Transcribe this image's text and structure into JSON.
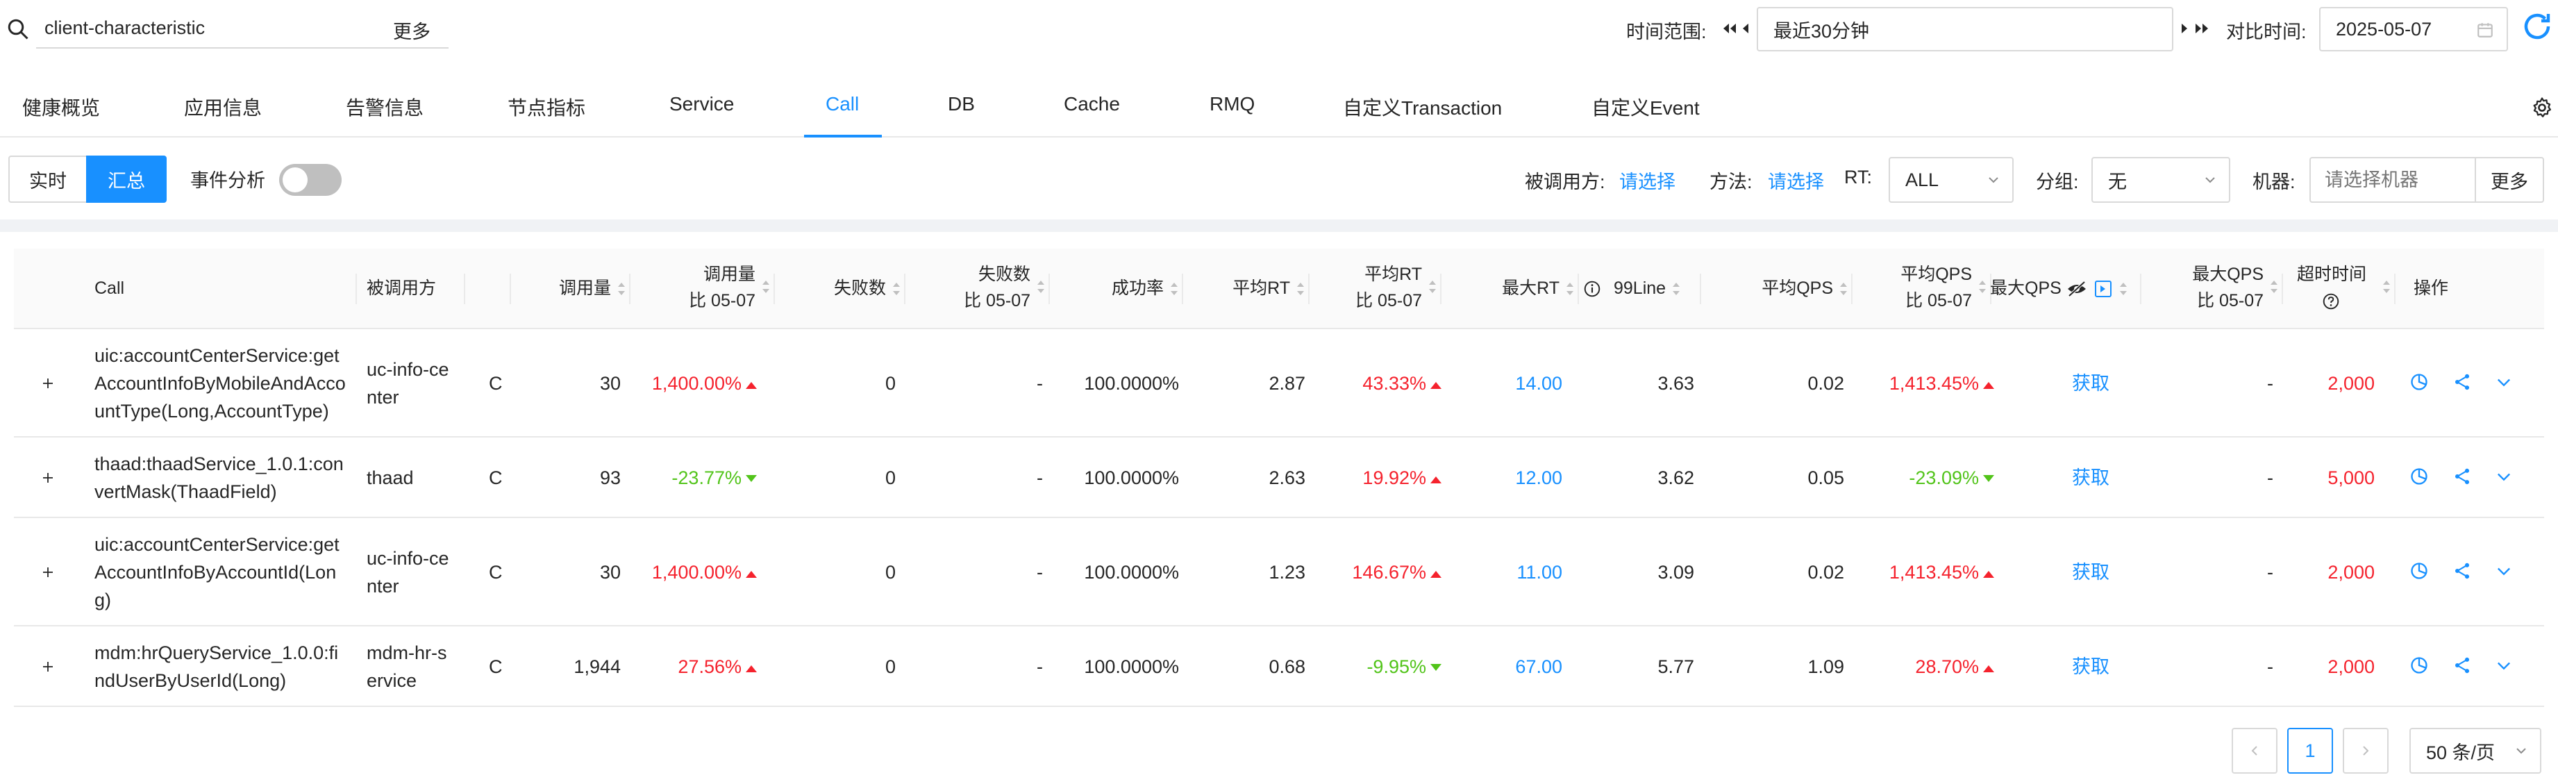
{
  "search": {
    "value": "client-characteristic",
    "more": "更多"
  },
  "time": {
    "label": "时间范围:",
    "range": "最近30分钟",
    "compare_label": "对比时间:",
    "compare_date": "2025-05-07"
  },
  "tabs": [
    "健康概览",
    "应用信息",
    "告警信息",
    "节点指标",
    "Service",
    "Call",
    "DB",
    "Cache",
    "RMQ",
    "自定义Transaction",
    "自定义Event"
  ],
  "active_tab": "Call",
  "mode": {
    "realtime": "实时",
    "summary": "汇总",
    "event_analysis": "事件分析",
    "event_analysis_on": false
  },
  "filters": {
    "callee_label": "被调用方:",
    "callee_value": "请选择",
    "method_label": "方法:",
    "method_value": "请选择",
    "rt_label": "RT:",
    "rt_value": "ALL",
    "group_label": "分组:",
    "group_value": "无",
    "machine_label": "机器:",
    "machine_placeholder": "请选择机器",
    "machine_more": "更多"
  },
  "columns": {
    "call": "Call",
    "callee": "被调用方",
    "calls": "调用量",
    "calls_cmp_1": "调用量",
    "calls_cmp_2": "比 05-07",
    "fails": "失败数",
    "fails_cmp_1": "失败数",
    "fails_cmp_2": "比 05-07",
    "success": "成功率",
    "avg_rt": "平均RT",
    "avg_rt_cmp_1": "平均RT",
    "avg_rt_cmp_2": "比 05-07",
    "max_rt": "最大RT",
    "line99": "99Line",
    "avg_qps": "平均QPS",
    "avg_qps_cmp_1": "平均QPS",
    "avg_qps_cmp_2": "比 05-07",
    "max_qps": "最大QPS",
    "max_qps_cmp_1": "最大QPS",
    "max_qps_cmp_2": "比 05-07",
    "timeout": "超时时间",
    "ops": "操作"
  },
  "rows": [
    {
      "call_lines": [
        "uic:accountCenterService:get",
        "AccountInfoByMobileAndAcco",
        "untType(Long,AccountType)"
      ],
      "callee_lines": [
        "uc-info-ce",
        "nter"
      ],
      "type": "C",
      "calls": "30",
      "calls_cmp": "1,400.00%",
      "calls_cmp_dir": "up",
      "fails": "0",
      "fails_cmp": "-",
      "success": "100.0000%",
      "avg_rt": "2.87",
      "avg_rt_cmp": "43.33%",
      "avg_rt_cmp_dir": "up",
      "max_rt": "14.00",
      "line99": "3.63",
      "avg_qps": "0.02",
      "avg_qps_cmp": "1,413.45%",
      "avg_qps_cmp_dir": "up",
      "max_qps": "获取",
      "max_qps_cmp": "-",
      "timeout": "2,000"
    },
    {
      "call_lines": [
        "thaad:thaadService_1.0.1:con",
        "vertMask(ThaadField)"
      ],
      "callee_lines": [
        "thaad"
      ],
      "type": "C",
      "calls": "93",
      "calls_cmp": "-23.77%",
      "calls_cmp_dir": "down",
      "fails": "0",
      "fails_cmp": "-",
      "success": "100.0000%",
      "avg_rt": "2.63",
      "avg_rt_cmp": "19.92%",
      "avg_rt_cmp_dir": "up",
      "max_rt": "12.00",
      "line99": "3.62",
      "avg_qps": "0.05",
      "avg_qps_cmp": "-23.09%",
      "avg_qps_cmp_dir": "down",
      "max_qps": "获取",
      "max_qps_cmp": "-",
      "timeout": "5,000"
    },
    {
      "call_lines": [
        "uic:accountCenterService:get",
        "AccountInfoByAccountId(Lon",
        "g)"
      ],
      "callee_lines": [
        "uc-info-ce",
        "nter"
      ],
      "type": "C",
      "calls": "30",
      "calls_cmp": "1,400.00%",
      "calls_cmp_dir": "up",
      "fails": "0",
      "fails_cmp": "-",
      "success": "100.0000%",
      "avg_rt": "1.23",
      "avg_rt_cmp": "146.67%",
      "avg_rt_cmp_dir": "up",
      "max_rt": "11.00",
      "line99": "3.09",
      "avg_qps": "0.02",
      "avg_qps_cmp": "1,413.45%",
      "avg_qps_cmp_dir": "up",
      "max_qps": "获取",
      "max_qps_cmp": "-",
      "timeout": "2,000"
    },
    {
      "call_lines": [
        "mdm:hrQueryService_1.0.0:fi",
        "ndUserByUserId(Long)"
      ],
      "callee_lines": [
        "mdm-hr-s",
        "ervice"
      ],
      "type": "C",
      "calls": "1,944",
      "calls_cmp": "27.56%",
      "calls_cmp_dir": "up",
      "fails": "0",
      "fails_cmp": "-",
      "success": "100.0000%",
      "avg_rt": "0.68",
      "avg_rt_cmp": "-9.95%",
      "avg_rt_cmp_dir": "down",
      "max_rt": "67.00",
      "line99": "5.77",
      "avg_qps": "1.09",
      "avg_qps_cmp": "28.70%",
      "avg_qps_cmp_dir": "up",
      "max_qps": "获取",
      "max_qps_cmp": "-",
      "timeout": "2,000"
    }
  ],
  "pagination": {
    "current": "1",
    "page_size": "50 条/页"
  },
  "colors": {
    "accent": "#1890ff",
    "up": "#f5222d",
    "down": "#52c41a"
  }
}
